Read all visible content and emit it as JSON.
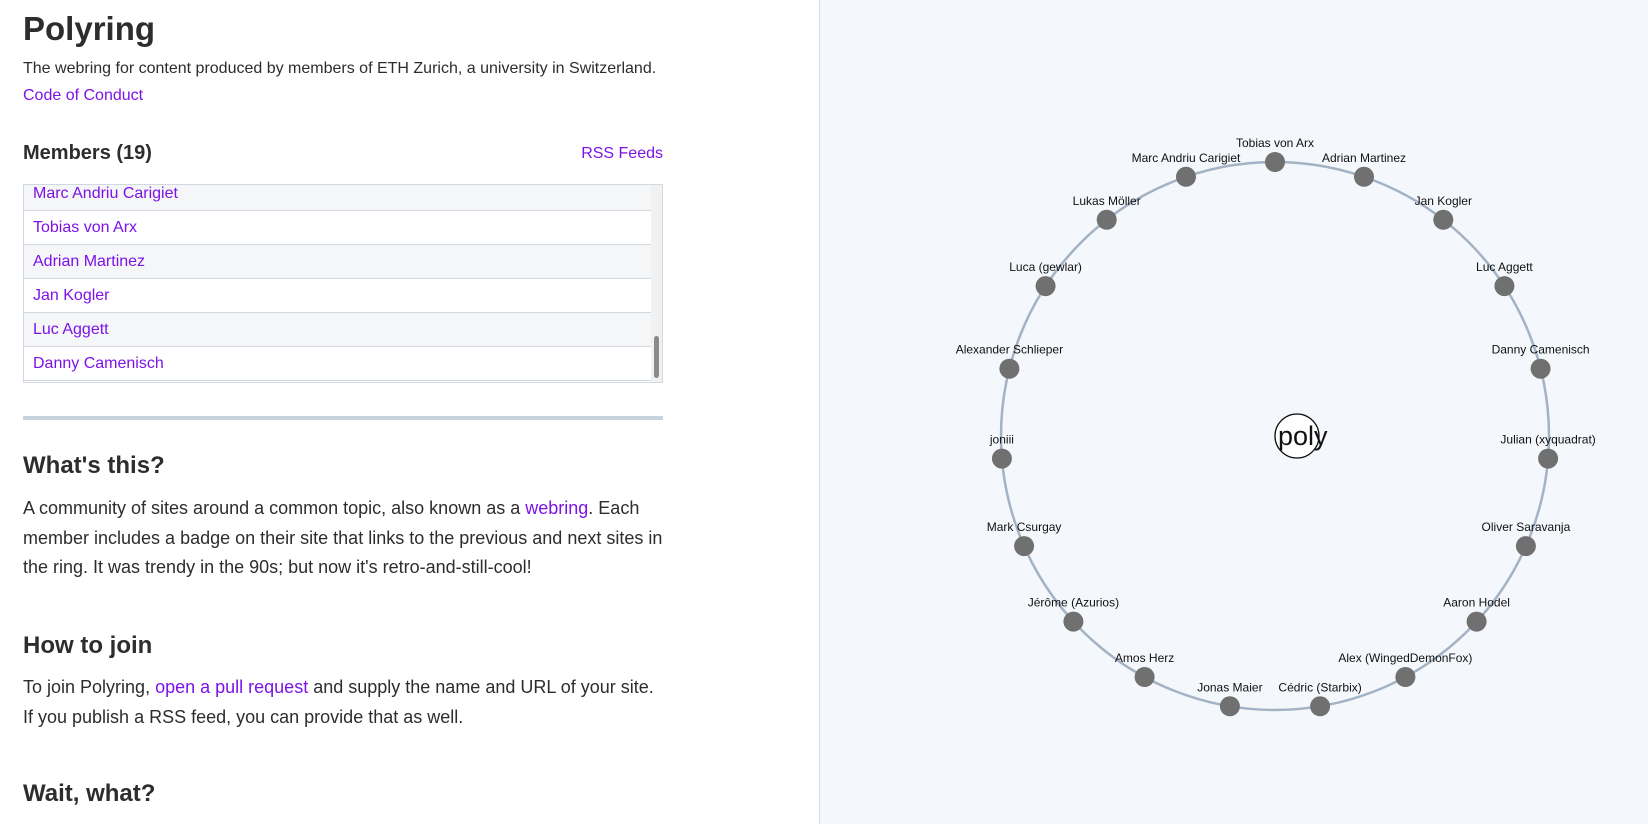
{
  "header": {
    "title": "Polyring",
    "subtitle": "The webring for content produced by members of ETH Zurich, a university in Switzerland.",
    "code_of_conduct": "Code of Conduct"
  },
  "members": {
    "heading": "Members (19)",
    "rss_link": "RSS Feeds",
    "list": [
      "Marc Andriu Carigiet",
      "Tobias von Arx",
      "Adrian Martinez",
      "Jan Kogler",
      "Luc Aggett",
      "Danny Camenisch"
    ]
  },
  "whats_this": {
    "heading": "What's this?",
    "text_before": "A community of sites around a common topic, also known as a ",
    "link": "webring",
    "text_after": ". Each member includes a badge on their site that links to the previous and next sites in the ring. It was trendy in the 90s; but now it's retro-and-still-cool!"
  },
  "how_to_join": {
    "heading": "How to join",
    "text_before": "To join Polyring, ",
    "link": "open a pull request",
    "text_after": " and supply the name and URL of your site. If you publish a RSS feed, you can provide that as well."
  },
  "wait_what": {
    "heading": "Wait, what?"
  },
  "ring": {
    "logo_text": "poly",
    "members": [
      "Tobias von Arx",
      "Adrian Martinez",
      "Jan Kogler",
      "Luc Aggett",
      "Danny Camenisch",
      "Julian (xyquadrat)",
      "Oliver Saravanja",
      "Aaron Hodel",
      "Alex (WingedDemonFox)",
      "Cédric (Starbix)",
      "Jonas Maier",
      "Amos Herz",
      "Jérôme (Azurios)",
      "Mark Csurgay",
      "joniii",
      "Alexander Schlieper",
      "Luca (gewlar)",
      "Lukas Möller",
      "Marc Andriu Carigiet"
    ]
  },
  "colors": {
    "link": "#7c12e6",
    "text": "#2d2d2d",
    "panel_bg": "#f4f7fb",
    "ring_line": "#a3b2c4",
    "node": "#707070"
  }
}
